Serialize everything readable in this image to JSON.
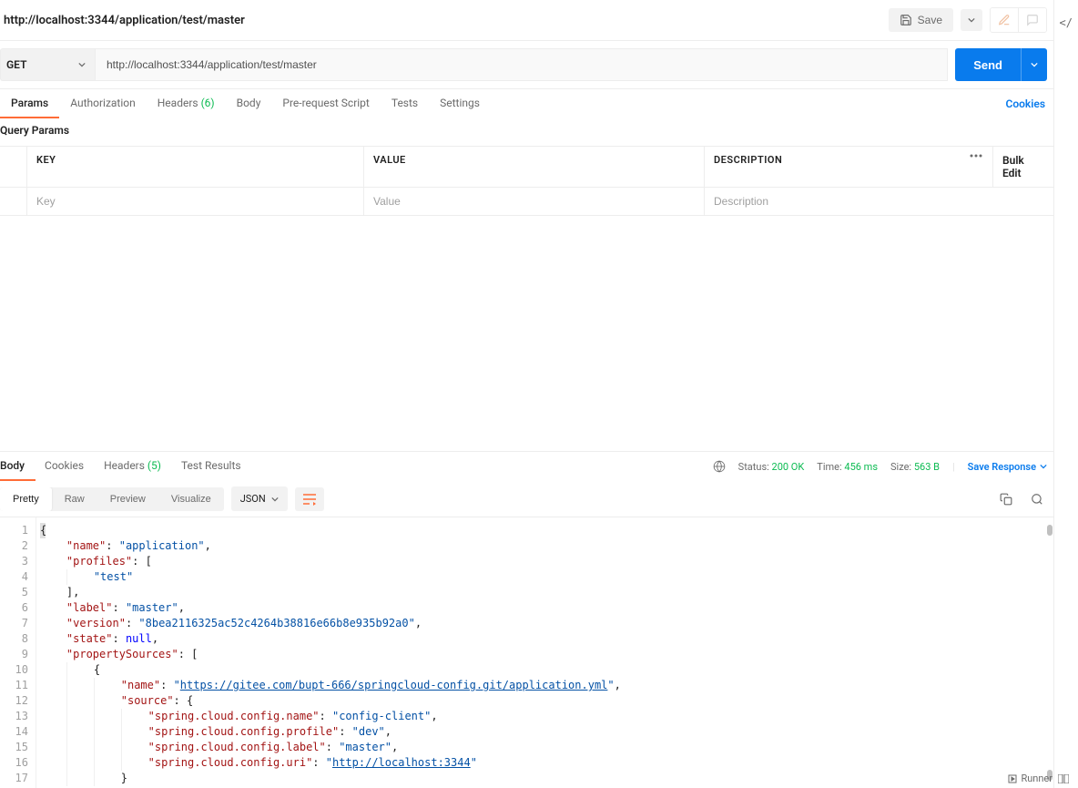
{
  "header": {
    "title": "http://localhost:3344/application/test/master",
    "save_label": "Save"
  },
  "request": {
    "method": "GET",
    "url": "http://localhost:3344/application/test/master",
    "send_label": "Send"
  },
  "request_tabs": {
    "params": "Params",
    "authorization": "Authorization",
    "headers": "Headers",
    "headers_count": "(6)",
    "body": "Body",
    "prerequest": "Pre-request Script",
    "tests": "Tests",
    "settings": "Settings",
    "cookies": "Cookies"
  },
  "params_section": {
    "title": "Query Params",
    "col_key": "KEY",
    "col_value": "VALUE",
    "col_desc": "DESCRIPTION",
    "bulk_edit": "Bulk Edit",
    "placeholder_key": "Key",
    "placeholder_value": "Value",
    "placeholder_desc": "Description"
  },
  "response_tabs": {
    "body": "Body",
    "cookies": "Cookies",
    "headers": "Headers",
    "headers_count": "(5)",
    "test_results": "Test Results"
  },
  "response_meta": {
    "status_label": "Status:",
    "status_value": "200 OK",
    "time_label": "Time:",
    "time_value": "456 ms",
    "size_label": "Size:",
    "size_value": "563 B",
    "save_response": "Save Response"
  },
  "view_modes": {
    "pretty": "Pretty",
    "raw": "Raw",
    "preview": "Preview",
    "visualize": "Visualize",
    "format": "JSON"
  },
  "response_body": {
    "name": "application",
    "profiles": [
      "test"
    ],
    "label": "master",
    "version": "8bea2116325ac52c4264b38816e66b8e935b92a0",
    "state": null,
    "propertySources": [
      {
        "name": "https://gitee.com/bupt-666/springcloud-config.git/application.yml",
        "source": {
          "spring.cloud.config.name": "config-client",
          "spring.cloud.config.profile": "dev",
          "spring.cloud.config.label": "master",
          "spring.cloud.config.uri": "http://localhost:3344"
        }
      }
    ]
  },
  "footer": {
    "runner": "Runner"
  }
}
